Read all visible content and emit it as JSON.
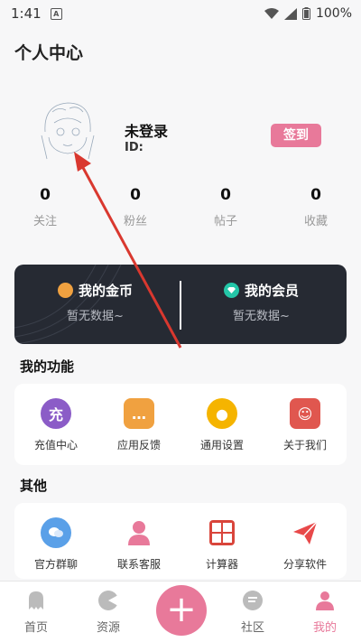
{
  "status_bar": {
    "time": "1:41",
    "a_icon": "A",
    "battery": "100%"
  },
  "page": {
    "title": "个人中心"
  },
  "profile": {
    "name": "未登录",
    "id_label": "ID:",
    "sign_in": "签到"
  },
  "stats": [
    {
      "value": "0",
      "label": "关注"
    },
    {
      "value": "0",
      "label": "粉丝"
    },
    {
      "value": "0",
      "label": "帖子"
    },
    {
      "value": "0",
      "label": "收藏"
    }
  ],
  "wallet": {
    "coins": {
      "label": "我的金币",
      "value": "暂无数据~",
      "icon": "coin-icon"
    },
    "vip": {
      "label": "我的会员",
      "value": "暂无数据~",
      "icon": "diamond-icon"
    }
  },
  "functions": {
    "title": "我的功能",
    "items": [
      {
        "label": "充值中心",
        "glyph": "充",
        "icon": "recharge-icon",
        "color": "#8b5cc7"
      },
      {
        "label": "应用反馈",
        "glyph": "…",
        "icon": "feedback-icon",
        "color": "#f0a140"
      },
      {
        "label": "通用设置",
        "glyph": "●",
        "icon": "gear-icon",
        "color": "#f5b400"
      },
      {
        "label": "关于我们",
        "glyph": "☺",
        "icon": "about-icon",
        "color": "#e0574f"
      }
    ]
  },
  "others": {
    "title": "其他",
    "items": [
      {
        "label": "官方群聊",
        "icon": "group-chat-icon",
        "color": "#5aa0e8"
      },
      {
        "label": "联系客服",
        "icon": "customer-service-icon",
        "color": "#e8799a"
      },
      {
        "label": "计算器",
        "icon": "calculator-icon",
        "color": "#d9453b"
      },
      {
        "label": "分享软件",
        "icon": "share-icon",
        "color": "#e8494a"
      }
    ]
  },
  "nav": {
    "home": "首页",
    "resources": "资源",
    "add": "+",
    "community": "社区",
    "mine": "我的"
  },
  "colors": {
    "accent": "#e8799a",
    "card_bg": "#262a33"
  }
}
